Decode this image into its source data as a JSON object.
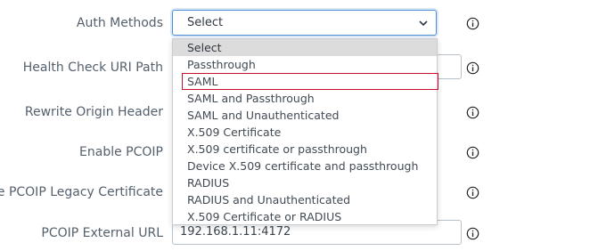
{
  "form": {
    "rows": [
      {
        "label": "Auth Methods"
      },
      {
        "label": "Health Check URI Path"
      },
      {
        "label": "Rewrite Origin Header"
      },
      {
        "label": "Enable PCOIP"
      },
      {
        "label": "ble PCOIP Legacy Certificate"
      },
      {
        "label": "PCOIP External URL",
        "value": "192.168.1.11:4172"
      }
    ],
    "auth_select_value": "Select"
  },
  "dropdown": {
    "options": [
      "Select",
      "Passthrough",
      "SAML",
      "SAML and Passthrough",
      "SAML and Unauthenticated",
      "X.509 Certificate",
      "X.509 certificate or passthrough",
      "Device X.509 certificate and passthrough",
      "RADIUS",
      "RADIUS and Unauthenticated",
      "X.509 Certificate or RADIUS"
    ],
    "selected_option": "Select",
    "hovered_option": "SAML"
  },
  "icons": {
    "info": "info-circle-icon",
    "chevron": "chevron-down-icon"
  },
  "colors": {
    "label": "#55606d",
    "focus_border": "#4f8fd6",
    "hover_outline": "#c8102e",
    "selected_bg": "#dcdcdc"
  }
}
